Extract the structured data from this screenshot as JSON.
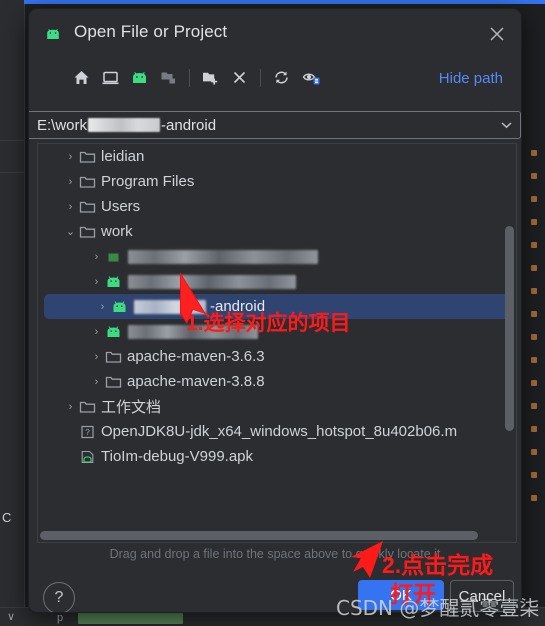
{
  "window": {
    "title": "Open File or Project",
    "app_icon": "android-icon",
    "close_icon": "close-icon"
  },
  "toolbar": {
    "buttons": [
      {
        "name": "home-icon",
        "tooltip": "Home"
      },
      {
        "name": "desktop-icon",
        "tooltip": "Desktop"
      },
      {
        "name": "android-project-icon",
        "tooltip": "Project Directory"
      },
      {
        "name": "folder-tree-icon",
        "tooltip": "Module Directory"
      },
      {
        "name": "new-folder-icon",
        "tooltip": "New Folder"
      },
      {
        "name": "delete-icon",
        "tooltip": "Delete"
      },
      {
        "name": "refresh-icon",
        "tooltip": "Refresh"
      },
      {
        "name": "show-hidden-icon",
        "tooltip": "Show Hidden Files"
      }
    ],
    "hide_path_label": "Hide path"
  },
  "path": {
    "prefix": "E:\\work",
    "redacted": true,
    "suffix": "-android",
    "dropdown_icon": "chevron-down-icon"
  },
  "tree": {
    "rows": [
      {
        "indent": 1,
        "arrow": "collapsed",
        "icon": "folder-icon",
        "label": "leidian",
        "redacted": false,
        "selected": false
      },
      {
        "indent": 1,
        "arrow": "collapsed",
        "icon": "folder-icon",
        "label": "Program Files",
        "redacted": false,
        "selected": false
      },
      {
        "indent": 1,
        "arrow": "collapsed",
        "icon": "folder-icon",
        "label": "Users",
        "redacted": false,
        "selected": false
      },
      {
        "indent": 1,
        "arrow": "expanded",
        "icon": "folder-icon",
        "label": "work",
        "redacted": false,
        "selected": false
      },
      {
        "indent": 2,
        "arrow": "collapsed",
        "icon": "module-icon",
        "label": "",
        "redacted": true,
        "redact_width": 190,
        "ghost": "",
        "selected": false
      },
      {
        "indent": 2,
        "arrow": "collapsed",
        "icon": "android-icon",
        "label": "",
        "redacted": true,
        "redact_width": 168,
        "ghost": "",
        "selected": false
      },
      {
        "indent": 2,
        "arrow": "collapsed",
        "icon": "android-icon",
        "label": "",
        "redacted": true,
        "redact_width": 72,
        "ghost": "-android",
        "selected": true
      },
      {
        "indent": 2,
        "arrow": "collapsed",
        "icon": "android-icon",
        "label": "",
        "redacted": true,
        "redact_width": 130,
        "ghost": "",
        "selected": false
      },
      {
        "indent": 2,
        "arrow": "collapsed",
        "icon": "folder-icon",
        "label": "apache-maven-3.6.3",
        "redacted": false,
        "selected": false
      },
      {
        "indent": 2,
        "arrow": "collapsed",
        "icon": "folder-icon",
        "label": "apache-maven-3.8.8",
        "redacted": false,
        "selected": false
      },
      {
        "indent": 1,
        "arrow": "collapsed",
        "icon": "folder-icon",
        "label": "工作文档",
        "redacted": false,
        "selected": false
      },
      {
        "indent": 1,
        "arrow": "none",
        "icon": "unknown-file-icon",
        "label": "OpenJDK8U-jdk_x64_windows_hotspot_8u402b06.m",
        "redacted": false,
        "selected": false
      },
      {
        "indent": 1,
        "arrow": "none",
        "icon": "apk-file-icon",
        "label": "TioIm-debug-V999.apk",
        "redacted": false,
        "selected": false
      }
    ]
  },
  "footer": {
    "hint": "Drag and drop a file into the space above to quickly locate it",
    "help_label": "?",
    "ok_label": "OK",
    "cancel_label": "Cancel"
  },
  "annotations": {
    "step1": "1.选择对应的项目",
    "step2": "2.点击完成",
    "step3": "打开",
    "watermark": "CSDN @梦醒贰零壹柒"
  },
  "colors": {
    "accent": "#3574f0",
    "link": "#548af7",
    "selection": "#2f4470",
    "dialog_bg": "#2b2d30",
    "annotation_red": "#ff1a1a",
    "android_green": "#3ddc84"
  }
}
